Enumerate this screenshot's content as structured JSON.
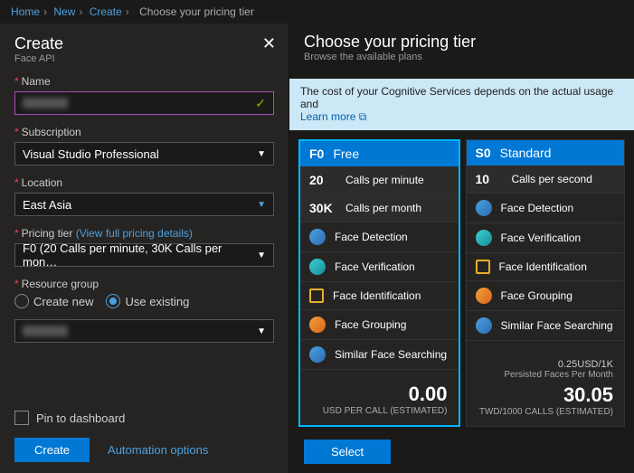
{
  "breadcrumb": [
    "Home",
    "New",
    "Create",
    "Choose your pricing tier"
  ],
  "left": {
    "title": "Create",
    "subtitle": "Face API",
    "name_label": "Name",
    "name_value": "",
    "subscription_label": "Subscription",
    "subscription_value": "Visual Studio Professional",
    "location_label": "Location",
    "location_value": "East Asia",
    "pricing_label": "Pricing tier",
    "pricing_link": "(View full pricing details)",
    "pricing_value": "F0 (20 Calls per minute, 30K Calls per mon…",
    "rg_label": "Resource group",
    "rg_create": "Create new",
    "rg_existing": "Use existing",
    "rg_value": "",
    "pin": "Pin to dashboard",
    "create_btn": "Create",
    "automation": "Automation options"
  },
  "right": {
    "title": "Choose your pricing tier",
    "subtitle": "Browse the available plans",
    "banner_text": "The cost of your Cognitive Services depends on the actual usage and",
    "banner_link": "Learn more",
    "tiers": [
      {
        "code": "F0",
        "name": "Free",
        "selected": true,
        "metrics": [
          {
            "k": "20",
            "v": "Calls per minute"
          },
          {
            "k": "30K",
            "v": "Calls per month"
          }
        ],
        "features": [
          "Face Detection",
          "Face Verification",
          "Face Identification",
          "Face Grouping",
          "Similar Face Searching"
        ],
        "sub_price": "",
        "sub_price2": "",
        "price": "0.00",
        "price_unit": "USD PER CALL (ESTIMATED)"
      },
      {
        "code": "S0",
        "name": "Standard",
        "selected": false,
        "metrics": [
          {
            "k": "10",
            "v": "Calls per second"
          }
        ],
        "features": [
          "Face Detection",
          "Face Verification",
          "Face Identification",
          "Face Grouping",
          "Similar Face Searching"
        ],
        "sub_price": "0.25USD/1K",
        "sub_price2": "Persisted Faces Per Month",
        "price": "30.05",
        "price_unit": "TWD/1000 CALLS (ESTIMATED)"
      }
    ],
    "select_btn": "Select"
  }
}
